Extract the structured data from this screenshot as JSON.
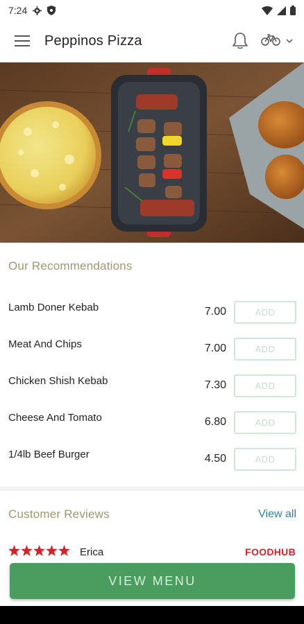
{
  "status_bar": {
    "time": "7:24",
    "icons": [
      "gear-icon",
      "shield-icon",
      "wifi-icon",
      "signal-icon",
      "battery-icon"
    ]
  },
  "app_bar": {
    "title": "Peppinos Pizza",
    "icons": [
      "hamburger-menu-icon",
      "bell-icon",
      "bicycle-icon",
      "chevron-down-icon"
    ]
  },
  "hero": {
    "description_icons": [
      "pizza",
      "kebab-skewers",
      "fried-chicken"
    ]
  },
  "recommendations": {
    "title": "Our Recommendations",
    "add_label": "ADD",
    "items": [
      {
        "name": "Lamb Doner Kebab",
        "price": "7.00"
      },
      {
        "name": "Meat And Chips",
        "price": "7.00"
      },
      {
        "name": "Chicken Shish Kebab",
        "price": "7.30"
      },
      {
        "name": "Cheese And Tomato",
        "price": "6.80"
      },
      {
        "name": "1/4lb Beef Burger",
        "price": "4.50"
      }
    ]
  },
  "reviews": {
    "title": "Customer Reviews",
    "view_all": "View all",
    "items": [
      {
        "rating": 5,
        "reviewer": "Erica",
        "source": "FOODHUB"
      }
    ]
  },
  "cta": {
    "label": "VIEW MENU"
  },
  "colors": {
    "accent_gold": "#a3956f",
    "cta_green": "#4a9d5f",
    "add_border": "#cfe6d8",
    "link_blue": "#2f7fa8",
    "star_red": "#d0232a"
  }
}
